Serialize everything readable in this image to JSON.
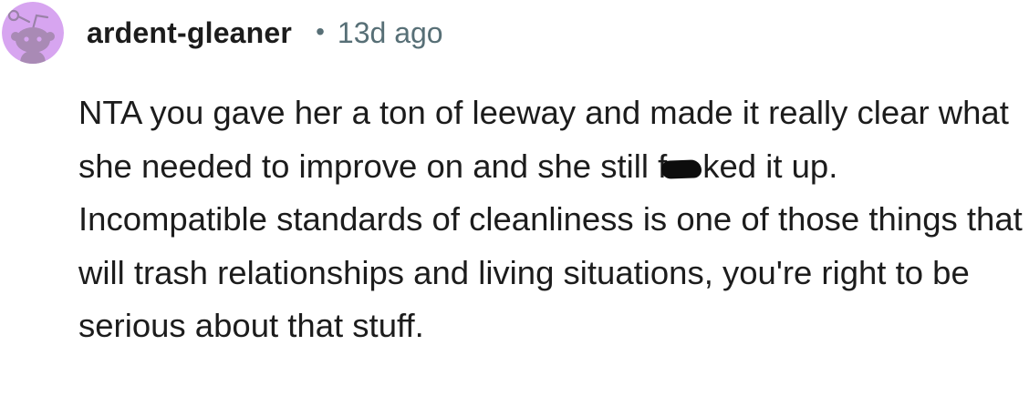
{
  "comment": {
    "avatar_icon": "snoo-avatar-icon",
    "avatar_color": "#d7a5f0",
    "username": "ardent-gleaner",
    "separator": "•",
    "timestamp": "13d ago",
    "body_prefix": "NTA you gave her a ton of leeway and made it really clear what she needed to improve on and she still f",
    "body_suffix": "ked it up. Incompatible standards of cleanliness is one of those things that will trash relationships and living situations, you're right to be serious about that stuff."
  }
}
